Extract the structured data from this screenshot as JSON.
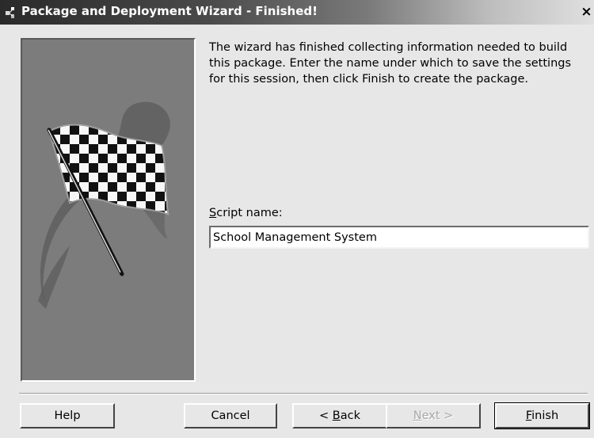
{
  "window": {
    "title": "Package and Deployment Wizard - Finished!",
    "close_glyph": "×"
  },
  "icons": {
    "title_icon": "package-wizard-icon",
    "illustration": "checkered-flag"
  },
  "main": {
    "description": "The wizard has finished collecting information needed to build this package. Enter the name under which to save the settings for this session, then click Finish to create the package.",
    "script_label_mnemonic": "S",
    "script_label_rest": "cript name:",
    "script_value": "School Management System"
  },
  "buttons": {
    "help": "Help",
    "cancel": "Cancel",
    "back_prefix": "< ",
    "back_mnemonic": "B",
    "back_rest": "ack",
    "next_mnemonic": "N",
    "next_rest": "ext >",
    "finish_mnemonic": "F",
    "finish_rest": "inish"
  }
}
